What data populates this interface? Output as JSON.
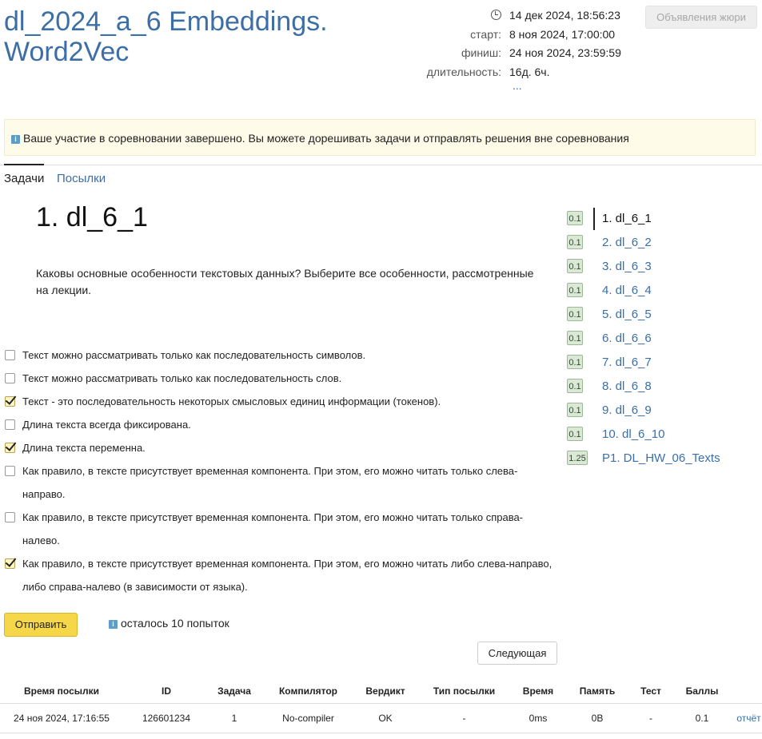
{
  "contest": {
    "title": "dl_2024_a_6 Embeddings. Word2Vec",
    "now": "14 дек 2024, 18:56:23",
    "start_label": "старт:",
    "start": "8 ноя 2024, 17:00:00",
    "finish_label": "финиш:",
    "finish": "24 ноя 2024, 23:59:59",
    "duration_label": "длительность:",
    "duration": "16д. 6ч.",
    "more": "...",
    "jury_button": "Объявления жюри"
  },
  "notice": "Ваше участие в соревновании завершено. Вы можете дорешивать задачи и отправлять решения вне соревнования",
  "tabs": [
    {
      "label": "Задачи",
      "active": true
    },
    {
      "label": "Посылки",
      "active": false
    }
  ],
  "problem": {
    "title": "1. dl_6_1",
    "statement": "Каковы основные особенности текстовых данных? Выберите все особенности, рассмотренные на лекции.",
    "options": [
      {
        "text": "Текст можно рассматривать только как последовательность символов.",
        "checked": false
      },
      {
        "text": "Текст можно рассматривать только как последовательность слов.",
        "checked": false
      },
      {
        "text": "Текст - это последовательность некоторых смысловых единиц информации (токенов).",
        "checked": true
      },
      {
        "text": "Длина текста всегда фиксирована.",
        "checked": false
      },
      {
        "text": "Длина текста переменна.",
        "checked": true
      },
      {
        "text": "Как правило, в тексте присутствует временная компонента. При этом, его можно читать только слева-направо.",
        "checked": false
      },
      {
        "text": "Как правило, в тексте присутствует временная компонента. При этом, его можно читать только справа-налево.",
        "checked": false
      },
      {
        "text": "Как правило, в тексте присутствует временная компонента. При этом, его можно читать либо слева-направо, либо справа-налево (в зависимости от языка).",
        "checked": true
      }
    ],
    "submit_label": "Отправить",
    "attempts_left": "осталось 10 попыток",
    "next_label": "Следующая"
  },
  "problem_list": [
    {
      "score": "0.1",
      "name": "1. dl_6_1",
      "current": true
    },
    {
      "score": "0.1",
      "name": "2. dl_6_2",
      "current": false
    },
    {
      "score": "0.1",
      "name": "3. dl_6_3",
      "current": false
    },
    {
      "score": "0.1",
      "name": "4. dl_6_4",
      "current": false
    },
    {
      "score": "0.1",
      "name": "5. dl_6_5",
      "current": false
    },
    {
      "score": "0.1",
      "name": "6. dl_6_6",
      "current": false
    },
    {
      "score": "0.1",
      "name": "7. dl_6_7",
      "current": false
    },
    {
      "score": "0.1",
      "name": "8. dl_6_8",
      "current": false
    },
    {
      "score": "0.1",
      "name": "9. dl_6_9",
      "current": false
    },
    {
      "score": "0.1",
      "name": "10. dl_6_10",
      "current": false
    },
    {
      "score": "1.25",
      "name": "P1. DL_HW_06_Texts",
      "current": false
    }
  ],
  "submissions": {
    "headers": [
      "Время посылки",
      "ID",
      "Задача",
      "Компилятор",
      "Вердикт",
      "Тип посылки",
      "Время",
      "Память",
      "Тест",
      "Баллы",
      ""
    ],
    "rows": [
      [
        "24 ноя 2024, 17:16:55",
        "126601234",
        "1",
        "No-compiler",
        "OK",
        "-",
        "0ms",
        "0B",
        "-",
        "0.1",
        "отчёт"
      ]
    ]
  },
  "colors": {
    "link": "#3a6fa8",
    "title": "#3d6ea6",
    "submit": "#f7d74a",
    "ok": "#2f9a2f",
    "notice_bg": "#fefbe9"
  }
}
